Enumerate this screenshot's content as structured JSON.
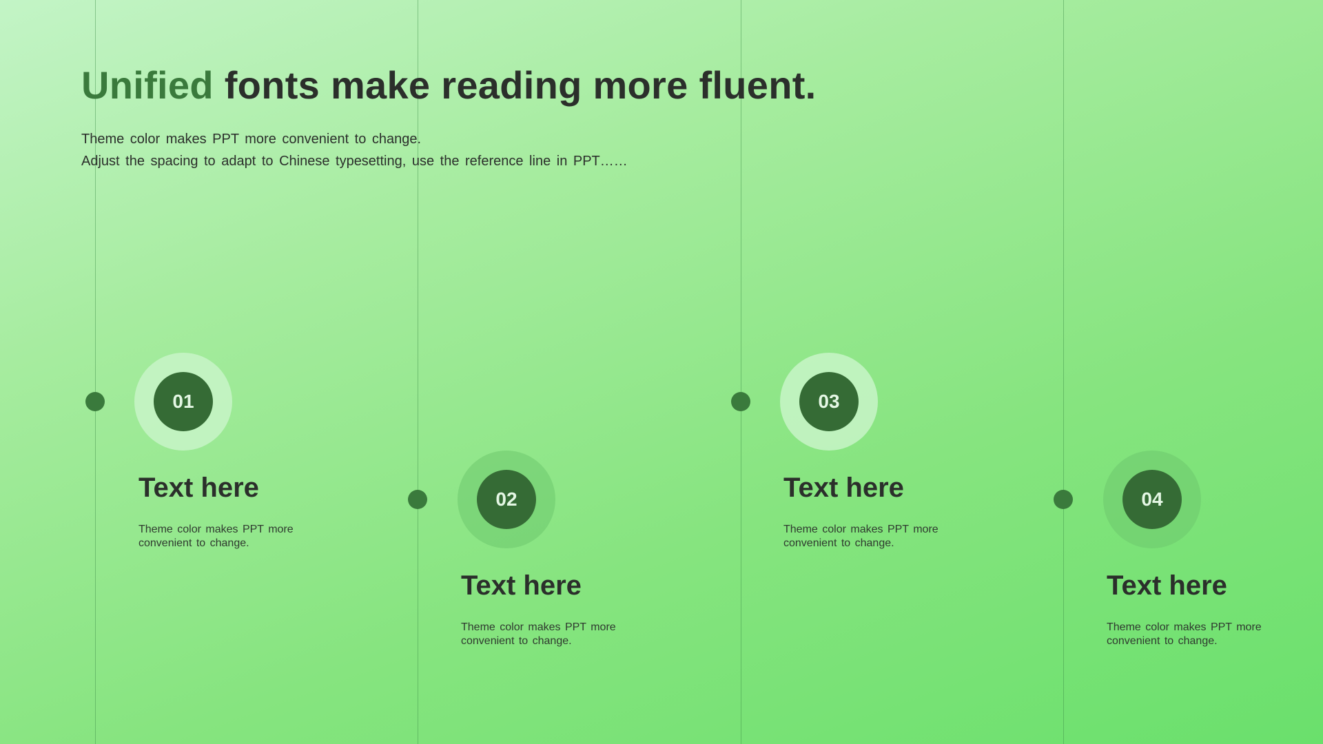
{
  "slide": {
    "title_accent": "Unified",
    "title_rest": " fonts make reading more fluent.",
    "subtitle_line1": "Theme color makes PPT more convenient to change.",
    "subtitle_line2": "Adjust the spacing to adapt to Chinese typesetting, use the reference line in PPT……"
  },
  "steps": [
    {
      "number": "01",
      "title": "Text here",
      "desc": "Theme color makes PPT more convenient to change."
    },
    {
      "number": "02",
      "title": "Text here",
      "desc": "Theme color makes PPT more convenient to change."
    },
    {
      "number": "03",
      "title": "Text here",
      "desc": "Theme color makes PPT more convenient to change."
    },
    {
      "number": "04",
      "title": "Text here",
      "desc": "Theme color makes PPT more convenient to change."
    }
  ],
  "colors": {
    "accent": "#3a7a3c",
    "badge": "#356b35",
    "text": "#2b2f2b"
  }
}
